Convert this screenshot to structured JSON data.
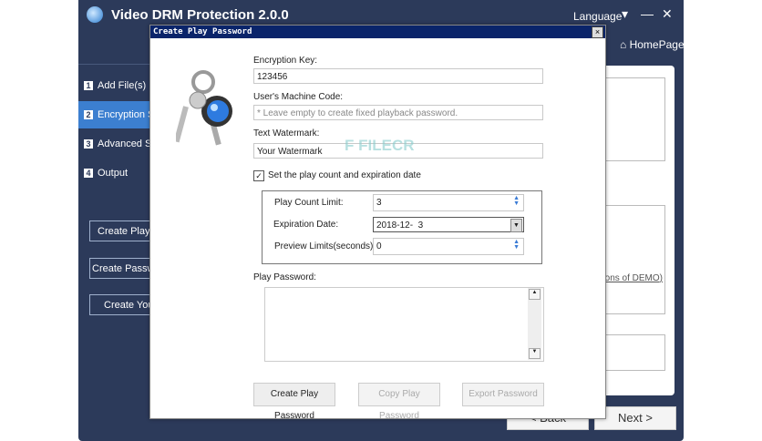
{
  "app": {
    "title": "Video DRM Protection 2.0.0",
    "language": "Language",
    "homepage": "HomePage"
  },
  "steps": [
    {
      "n": "1",
      "label": "Add File(s)"
    },
    {
      "n": "2",
      "label": "Encryption Settings"
    },
    {
      "n": "3",
      "label": "Advanced Settings"
    },
    {
      "n": "4",
      "label": "Output"
    }
  ],
  "left_buttons": [
    "Create Play Password",
    "Create Password",
    "Create Your"
  ],
  "right": {
    "link": "(Limitations of DEMO)",
    "back": "< Back",
    "next": "Next >"
  },
  "dialog": {
    "title": "Create Play Password",
    "close": "×",
    "encryption_key_label": "Encryption Key:",
    "encryption_key": "123456",
    "machine_code_label": "User's Machine Code:",
    "machine_code_placeholder": "* Leave empty to create fixed playback password.",
    "watermark_label": "Text Watermark:",
    "watermark": "Your Watermark",
    "checkbox_label": "Set the play count and expiration date",
    "checkbox_checked": true,
    "play_count_label": "Play Count Limit:",
    "play_count": "3",
    "expiration_label": "Expiration Date:",
    "expiration": "2018-12-  3",
    "preview_label": "Preview Limits(seconds):",
    "preview": "0",
    "play_password_label": "Play Password:",
    "play_password": "",
    "buttons": {
      "create": "Create Play Password",
      "copy": "Copy Play Password",
      "export": "Export Password"
    }
  },
  "watermark_logo": "FILECR .com"
}
